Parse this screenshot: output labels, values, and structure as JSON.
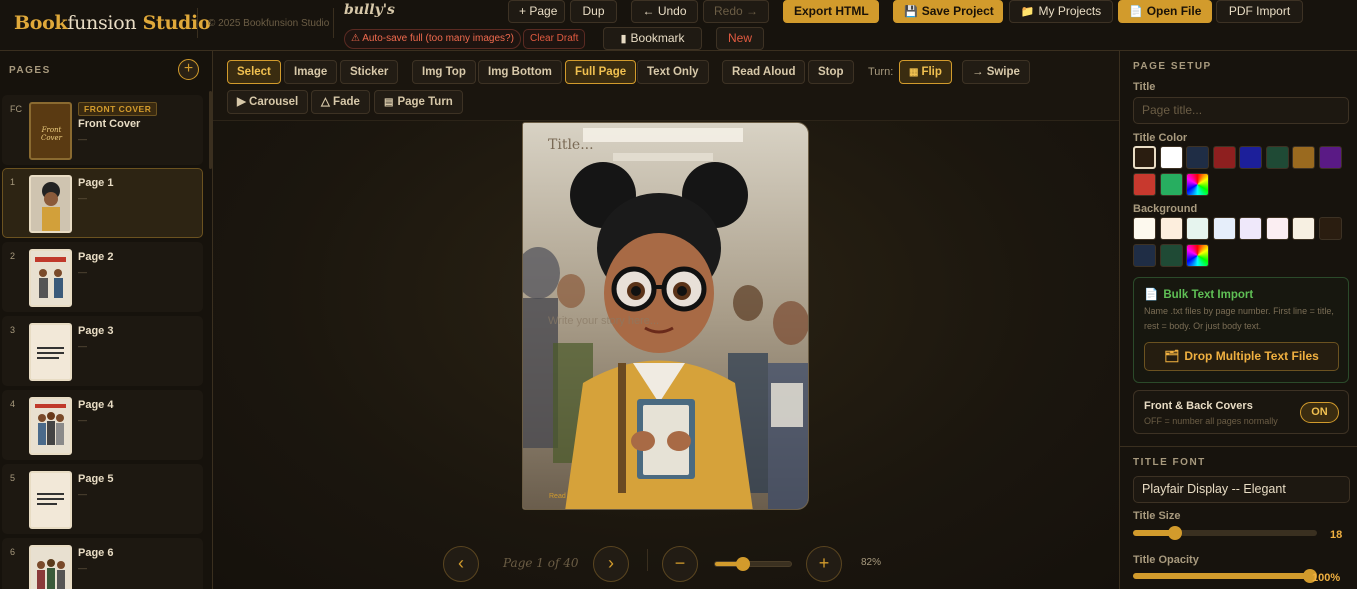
{
  "app": {
    "brand_bold": "Book",
    "brand_light": "funsion",
    "brand_studio": "Studio",
    "copyright": "© 2025 Bookfunsion Studio",
    "book_title": "bully's",
    "autosave_warning": "⚠ Auto-save full (too many images?)",
    "clear_draft": "Clear Draft"
  },
  "toolbar": {
    "add_page": "+ Page",
    "dup": "Dup",
    "undo": "← Undo",
    "redo": "Redo →",
    "bookmark": "Bookmark",
    "new": "New",
    "export_html": "Export HTML",
    "save_project": "Save Project",
    "my_projects": "My Projects",
    "open_file": "Open File",
    "pdf_import": "PDF Import"
  },
  "pages_panel": {
    "heading": "PAGES",
    "add_label": "+",
    "cover": {
      "num": "FC",
      "badge": "FRONT COVER",
      "name": "Front Cover",
      "sub": "—",
      "thumb_text": "Front Cover"
    },
    "items": [
      {
        "num": "1",
        "name": "Page 1",
        "sub": "—",
        "active": true
      },
      {
        "num": "2",
        "name": "Page 2",
        "sub": "—"
      },
      {
        "num": "3",
        "name": "Page 3",
        "sub": "—"
      },
      {
        "num": "4",
        "name": "Page 4",
        "sub": "—"
      },
      {
        "num": "5",
        "name": "Page 5",
        "sub": "—"
      },
      {
        "num": "6",
        "name": "Page 6",
        "sub": "—"
      }
    ]
  },
  "editor_tools": {
    "row1": [
      "Select",
      "Image",
      "Sticker",
      "Img Top",
      "Img Bottom",
      "Full Page",
      "Text Only",
      "Read Aloud",
      "Stop"
    ],
    "selected": [
      "Select",
      "Full Page"
    ],
    "turn_label": "Turn:",
    "flip": "Flip",
    "swipe": "→ Swipe",
    "carousel": "▶ Carousel",
    "fade": "△ Fade",
    "page_turn": "Page Turn"
  },
  "canvas": {
    "title_placeholder": "Title...",
    "body_placeholder": "Write your story here...",
    "read_label": "Read"
  },
  "navigation": {
    "prev": "‹",
    "next": "›",
    "page_indicator": "Page 1 of 40",
    "zoom_out": "−",
    "zoom_in": "+",
    "zoom_percent": "82%",
    "zoom_level": 0.36
  },
  "page_setup": {
    "heading": "PAGE SETUP",
    "title_label": "Title",
    "title_placeholder": "Page title...",
    "title_color_label": "Title Color",
    "title_colors": [
      "#2a1d10",
      "#ffffff",
      "#1f2d45",
      "#8e1f1f",
      "#1c1f9a",
      "#1f4a35",
      "#9a6a1f",
      "#5a1a85",
      "#c8392e",
      "#27ae60",
      "rainbow"
    ],
    "background_label": "Background",
    "background_colors": [
      "#fdf9ee",
      "#fdeedd",
      "#e6f4ee",
      "#e6eefa",
      "#efe8fa",
      "#fbeef2",
      "#f7f0e2",
      "#2a1d10",
      "#1f2d45",
      "#1f4a35",
      "rainbow"
    ],
    "bulk_title": "Bulk Text Import",
    "bulk_desc": "Name .txt files by page number. First line = title, rest = body. Or just body text.",
    "drop_button": "Drop Multiple Text Files",
    "covers_title": "Front & Back Covers",
    "covers_desc": "OFF = number all pages normally",
    "covers_toggle": "ON",
    "title_font_heading": "TITLE FONT",
    "title_font": "Playfair Display -- Elegant",
    "title_size_label": "Title Size",
    "title_size": "18",
    "title_size_level": 0.23,
    "title_opacity_label": "Title Opacity",
    "title_opacity": "100%",
    "title_opacity_level": 1.0
  }
}
